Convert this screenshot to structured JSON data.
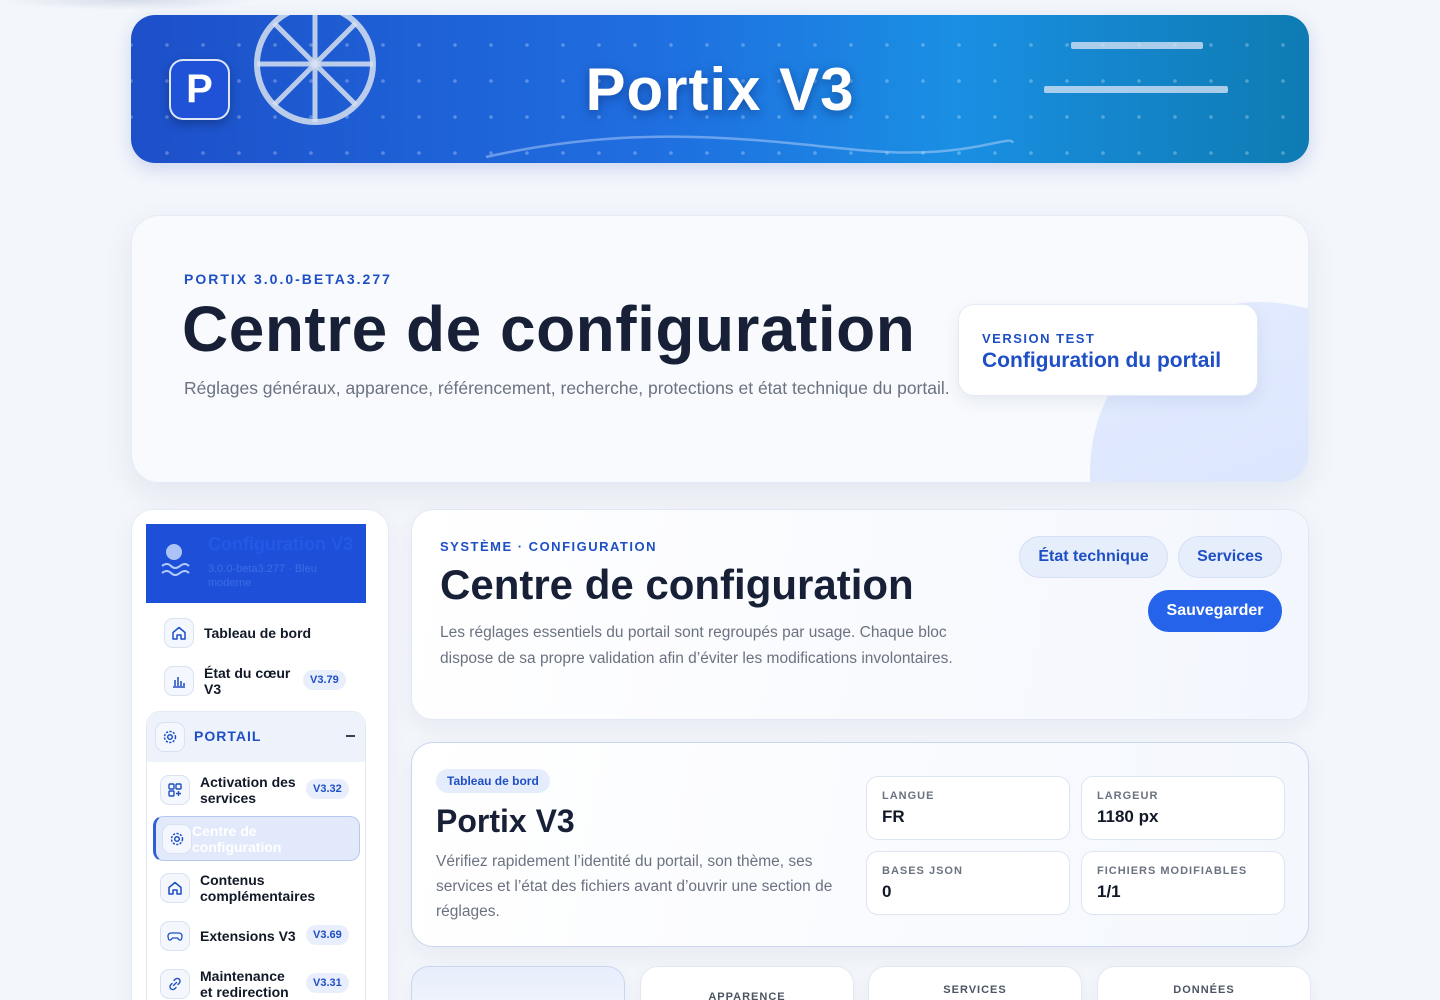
{
  "banner": {
    "logo_letter": "P",
    "title": "Portix V3"
  },
  "hero": {
    "eyebrow": "PORTIX 3.0.0-BETA3.277",
    "title": "Centre de configuration",
    "description": "Réglages généraux, apparence, référencement, recherche, protections et état technique du portail.",
    "version_label": "VERSION TEST",
    "version_value": "Configuration du portail"
  },
  "sidebar": {
    "header_title": "Configuration V3",
    "header_subtitle": "3.0.0-beta3.277 · Bleu moderne",
    "items": [
      {
        "label": "Tableau de bord",
        "icon": "home-icon"
      },
      {
        "label": "État du cœur V3",
        "icon": "chart-icon",
        "badge": "V3.79"
      }
    ],
    "section": {
      "label": "PORTAIL",
      "icon": "gear-icon",
      "items": [
        {
          "label": "Activation des services",
          "icon": "grid-plus-icon",
          "badge": "V3.32"
        },
        {
          "label": "Centre de configuration",
          "icon": "gear-icon",
          "active": true
        },
        {
          "label": "Contenus complémentaires",
          "icon": "home-icon"
        },
        {
          "label": "Extensions V3",
          "icon": "gamepad-icon",
          "badge": "V3.69"
        },
        {
          "label": "Maintenance et redirection",
          "icon": "link-icon",
          "badge": "V3.31"
        }
      ]
    }
  },
  "intro": {
    "eyebrow": "SYSTÈME · CONFIGURATION",
    "title": "Centre de configuration",
    "description": "Les réglages essentiels du portail sont regroupés par usage. Chaque bloc dispose de sa propre validation afin d’éviter les modifications involontaires.",
    "buttons": {
      "tech": "État technique",
      "services": "Services",
      "save": "Sauvegarder"
    }
  },
  "dashboard": {
    "tag": "Tableau de bord",
    "title": "Portix V3",
    "description": "Vérifiez rapidement l’identité du portail, son thème, ses services et l’état des fichiers avant d’ouvrir une section de réglages.",
    "stats": [
      {
        "label": "LANGUE",
        "value": "FR"
      },
      {
        "label": "LARGEUR",
        "value": "1180 px"
      },
      {
        "label": "BASES JSON",
        "value": "0"
      },
      {
        "label": "FICHIERS MODIFIABLES",
        "value": "1/1"
      }
    ]
  },
  "tiles": [
    {
      "label": ""
    },
    {
      "label": "APPARENCE"
    },
    {
      "label": "SERVICES"
    },
    {
      "label": "DONNÉES"
    }
  ],
  "colors": {
    "accent": "#2563eb",
    "brand_dark": "#1e4fc4",
    "text": "#172036"
  }
}
